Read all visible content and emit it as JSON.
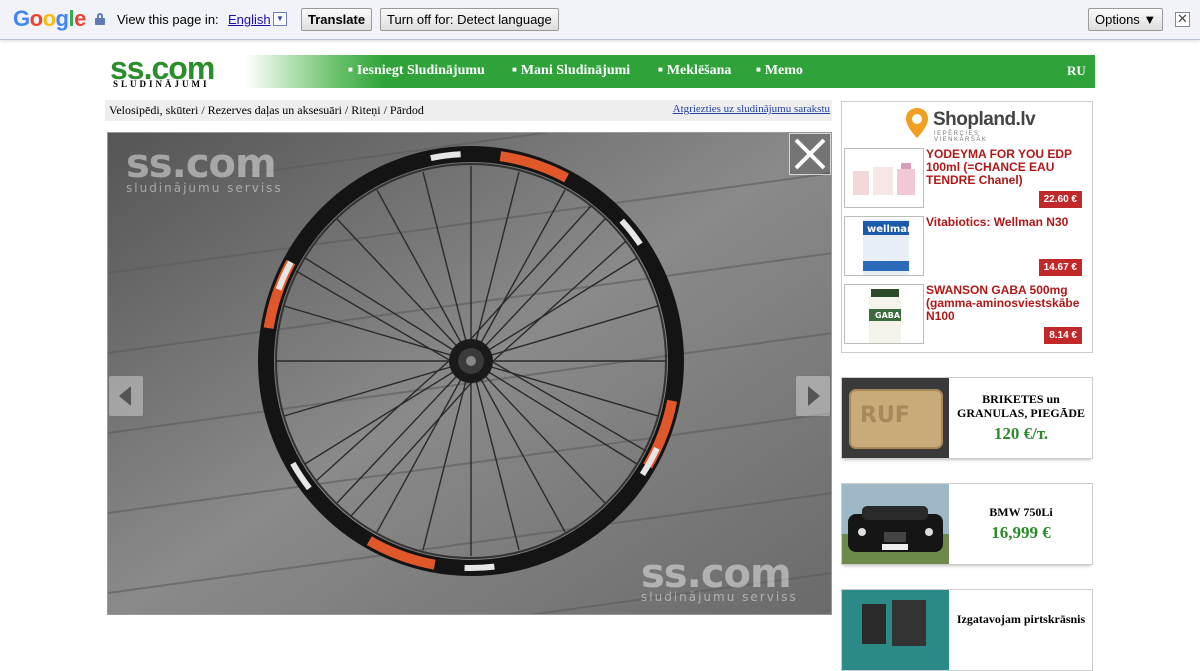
{
  "translate_bar": {
    "logo_letters": [
      "G",
      "o",
      "o",
      "g",
      "l",
      "e"
    ],
    "view_text": "View this page in:",
    "language": "English",
    "translate_label": "Translate",
    "turn_off_label": "Turn off for: Detect language",
    "options_label": "Options ▼",
    "close_glyph": "✕"
  },
  "site": {
    "logo_main": "ss.com",
    "logo_sub": "SLUDINĀJUMI",
    "nav": [
      "Iesniegt Sludinājumu",
      "Mani Sludinājumi",
      "Meklēšana",
      "Memo"
    ],
    "lang_switch": "RU"
  },
  "breadcrumb": {
    "path": "Velosipēdi, skūteri / Rezerves daļas un aksesuāri / Riteņi / Pārdod",
    "back_link": "Atgriezties uz sludinājumu sarakstu"
  },
  "photo": {
    "watermark_main": "ss.com",
    "watermark_sub": "sludinājumu serviss",
    "close_icon": "close-icon",
    "prev_icon": "chevron-left-icon",
    "next_icon": "chevron-right-icon"
  },
  "shopland": {
    "brand": "Shopland.lv",
    "tagline": "IEPĒRCIES VIENKĀRŠĀK",
    "products": [
      {
        "title": "YODEYMA FOR YOU EDP 100ml (=CHANCE EAU TENDRE Chanel)",
        "price": "22.60 €"
      },
      {
        "title": "Vitabiotics: Wellman N30",
        "price": "14.67 €"
      },
      {
        "title": "SWANSON GABA 500mg (gamma-aminosviestskābe N100",
        "price": "8.14 €"
      }
    ]
  },
  "ads": [
    {
      "head": "BRIKETES un GRANULAS, PIEGĀDE",
      "value": "120 €/т."
    },
    {
      "head": "BMW 750Li",
      "value": "16,999 €"
    },
    {
      "head": "Izgatavojam pirtskrāsnis",
      "value": ""
    }
  ],
  "colors": {
    "nav_green": "#2fa33a",
    "logo_green": "#2b8e2b",
    "price_red": "#c0282a",
    "product_title": "#b01818",
    "link_blue": "#2541a8"
  }
}
